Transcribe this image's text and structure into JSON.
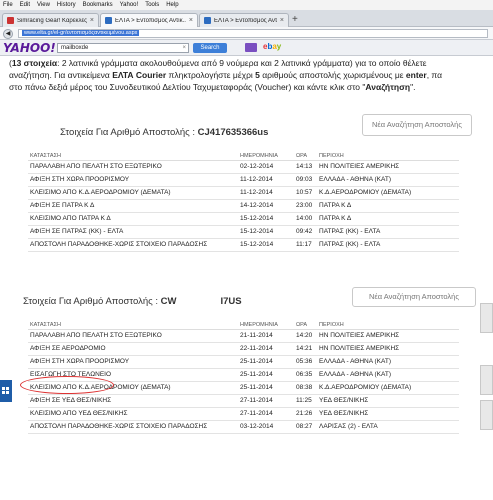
{
  "browser": {
    "menu": [
      "File",
      "Edit",
      "View",
      "History",
      "Bookmarks",
      "Yahoo!",
      "Tools",
      "Help"
    ],
    "tabs": [
      {
        "title": "Simracing Gear! Καρέκλες ..."
      },
      {
        "title": "ΕΛΤΑ > Εντοπισμός Αντικ..."
      },
      {
        "title": "ΕΛΤΑ > Εντοπισμός Αντικ..."
      }
    ],
    "new_tab": "+",
    "url": "www.elta.gr/el-gr/εντοπισμόςαντικειμένου.aspx",
    "yahoo_logo": "YAHOO!",
    "search_value": "mailboxde",
    "search_button": "Search",
    "ebay": [
      "e",
      "b",
      "a",
      "y"
    ]
  },
  "intro": {
    "line1_bold": "13 στοιχεία",
    "line1": ": 2 λατινικά γράμματα ακολουθούμενα από 9 νούμερα και 2 λατινικά γράμματα) για το οποίο θέλετε",
    "line2": "αναζήτηση. Για αντικείμενα ",
    "line2_bold": "ΕΛΤΑ Courier",
    "line2b": " πληκτρολογήστε μέχρι ",
    "line2_bold2": "5",
    "line2c": " αριθμούς αποστολής χωρισμένους με ",
    "line2_bold3": "enter",
    "line2d": ", πα",
    "line3": "στο πάνω δεξιά μέρος του Συνοδευτικού Δελτίου Ταχυμεταφοράς (Voucher) και κάντε κλικ στο \"",
    "line3_bold": "Αναζήτηση",
    "line3b": "\"."
  },
  "block1": {
    "title_prefix": "Στοιχεία Για Αριθμό Αποστολής : ",
    "tracking": "CJ417635366us",
    "new_search": "Νέα Αναζήτηση Αποστολής",
    "headers": [
      "ΚΑΤΑΣΤΑΣΗ",
      "ΗΜΕΡΟΜΗΝΙΑ",
      "ΩΡΑ",
      "ΠΕΡΙΟΧΗ"
    ],
    "rows": [
      [
        "ΠΑΡΑΛΑΒΗ ΑΠΟ ΠΕΛΑΤΗ ΣΤΟ ΕΞΩΤΕΡΙΚΟ",
        "02-12-2014",
        "14:13",
        "ΗΝ ΠΟΛΙΤΕΙΕΣ ΑΜΕΡΙΚΗΣ"
      ],
      [
        "ΑΦΙΞΗ ΣΤΗ ΧΩΡΑ ΠΡΟΟΡΙΣΜΟΥ",
        "11-12-2014",
        "09:03",
        "ΕΛΛΑΔΑ - ΑΘΗΝΑ (ΚΑΤ)"
      ],
      [
        "ΚΛΕΙΣΙΜΟ ΑΠΟ Κ.Δ.ΑΕΡΟΔΡΟΜΙΟΥ (ΔΕΜΑΤΑ)",
        "11-12-2014",
        "10:57",
        "Κ.Δ.ΑΕΡΟΔΡΟΜΙΟΥ (ΔΕΜΑΤΑ)"
      ],
      [
        "ΑΦΙΞΗ ΣΕ ΠΑΤΡΑ Κ Δ",
        "14-12-2014",
        "23:00",
        "ΠΑΤΡΑ Κ Δ"
      ],
      [
        "ΚΛΕΙΣΙΜΟ ΑΠΟ ΠΑΤΡΑ Κ Δ",
        "15-12-2014",
        "14:00",
        "ΠΑΤΡΑ Κ Δ"
      ],
      [
        "ΑΦΙΞΗ ΣΕ ΠΑΤΡΑΣ (ΚΚ) - ΕΛΤΑ",
        "15-12-2014",
        "09:42",
        "ΠΑΤΡΑΣ (ΚΚ) - ΕΛΤΑ"
      ],
      [
        "ΑΠΟΣΤΟΛΗ ΠΑΡΑΔΟΘΗΚΕ-ΧΩΡΙΣ ΣΤΟΙΧΕΙΟ ΠΑΡΑΔΟΣΗΣ",
        "15-12-2014",
        "11:17",
        "ΠΑΤΡΑΣ (ΚΚ) - ΕΛΤΑ"
      ]
    ]
  },
  "block2": {
    "title_prefix": "Στοιχεία Για Αριθμό Αποστολής : ",
    "tracking_a": "CW",
    "tracking_b": "I7US",
    "new_search": "Νέα Αναζήτηση Αποστολής",
    "headers": [
      "ΚΑΤΑΣΤΑΣΗ",
      "ΗΜΕΡΟΜΗΝΙΑ",
      "ΩΡΑ",
      "ΠΕΡΙΟΧΗ"
    ],
    "rows": [
      [
        "ΠΑΡΑΛΑΒΗ ΑΠΟ ΠΕΛΑΤΗ ΣΤΟ ΕΞΩΤΕΡΙΚΟ",
        "21-11-2014",
        "14:20",
        "ΗΝ ΠΟΛΙΤΕΙΕΣ ΑΜΕΡΙΚΗΣ"
      ],
      [
        "ΑΦΙΞΗ ΣΕ ΑΕΡΟΔΡΟΜΙΟ",
        "22-11-2014",
        "14:21",
        "ΗΝ ΠΟΛΙΤΕΙΕΣ ΑΜΕΡΙΚΗΣ"
      ],
      [
        "ΑΦΙΞΗ ΣΤΗ ΧΩΡΑ ΠΡΟΟΡΙΣΜΟΥ",
        "25-11-2014",
        "05:36",
        "ΕΛΛΑΔΑ - ΑΘΗΝΑ (ΚΑΤ)"
      ],
      [
        "ΕΙΣΑΓΩΓΗ ΣΤΟ ΤΕΛΩΝΕΙΟ",
        "25-11-2014",
        "06:35",
        "ΕΛΛΑΔΑ - ΑΘΗΝΑ (ΚΑΤ)"
      ],
      [
        "ΚΛΕΙΣΙΜΟ ΑΠΟ Κ.Δ.ΑΕΡΟΔΡΟΜΙΟΥ (ΔΕΜΑΤΑ)",
        "25-11-2014",
        "08:38",
        "Κ.Δ.ΑΕΡΟΔΡΟΜΙΟΥ (ΔΕΜΑΤΑ)"
      ],
      [
        "ΑΦΙΞΗ ΣΕ ΥΕΔ ΘΕΣ/ΝΙΚΗΣ",
        "27-11-2014",
        "11:25",
        "ΥΕΔ ΘΕΣ/ΝΙΚΗΣ"
      ],
      [
        "ΚΛΕΙΣΙΜΟ ΑΠΟ ΥΕΔ ΘΕΣ/ΝΙΚΗΣ",
        "27-11-2014",
        "21:26",
        "ΥΕΔ ΘΕΣ/ΝΙΚΗΣ"
      ],
      [
        "ΑΠΟΣΤΟΛΗ ΠΑΡΑΔΟΘΗΚΕ-ΧΩΡΙΣ ΣΤΟΙΧΕΙΟ ΠΑΡΑΔΟΣΗΣ",
        "03-12-2014",
        "08:27",
        "ΛΑΡΙΣΑΣ (2) - ΕΛΤΑ"
      ]
    ]
  },
  "colors": {
    "highlight_circle": "#dd3333",
    "yahoo_purple": "#5a1a9a",
    "search_blue": "#3d7fd8"
  }
}
